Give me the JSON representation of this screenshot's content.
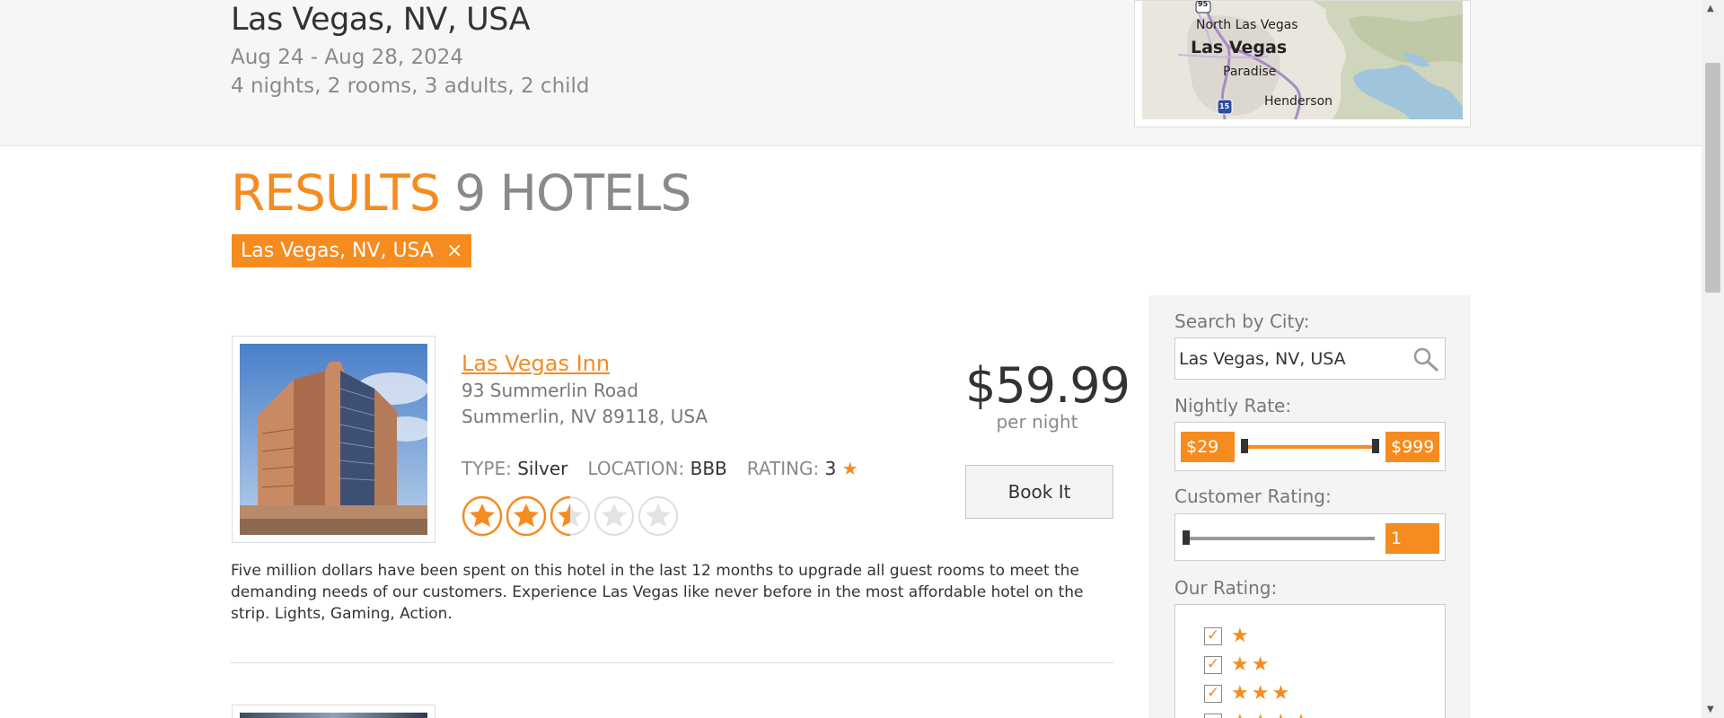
{
  "search_summary": {
    "destination": "Las Vegas, NV, USA",
    "dates": "Aug 24 - Aug 28, 2024",
    "summary": "4 nights, 2 rooms, 3 adults, 2 child"
  },
  "map": {
    "labels": {
      "route_95": "95",
      "north_las_vegas": "North Las Vegas",
      "las_vegas": "Las Vegas",
      "paradise": "Paradise",
      "route_15": "15",
      "henderson": "Henderson"
    }
  },
  "results": {
    "word": "RESULTS",
    "count": "9 HOTELS"
  },
  "active_filter": {
    "label": "Las Vegas, NV, USA",
    "remove": "×"
  },
  "hotels": [
    {
      "name": "Las Vegas Inn",
      "address_line1": "93 Summerlin Road",
      "address_line2": "Summerlin, NV 89118, USA",
      "type_label": "TYPE:",
      "type_value": "Silver",
      "location_label": "LOCATION:",
      "location_value": "BBB",
      "rating_label": "RATING:",
      "rating_value": "3",
      "review_stars": 2.5,
      "review_stars_max": 5,
      "price": "$59.99",
      "per_night": "per night",
      "book_label": "Book It",
      "description": "Five million dollars have been spent on this hotel in the last 12 months to upgrade all guest rooms to meet the demanding needs of our customers. Experience Las Vegas like never before in the most affordable hotel on the strip. Lights, Gaming, Action."
    }
  ],
  "sidebar": {
    "city_label": "Search by City:",
    "city_value": "Las Vegas, NV, USA",
    "rate_label": "Nightly Rate:",
    "rate_min": "$29",
    "rate_max": "$999",
    "customer_rating_label": "Customer Rating:",
    "customer_rating_value": "1",
    "our_rating_label": "Our Rating:",
    "our_rating_options": [
      {
        "stars": "★",
        "checked": true
      },
      {
        "stars": "★★",
        "checked": true
      },
      {
        "stars": "★★★",
        "checked": true
      },
      {
        "stars": "★★★★",
        "checked": false
      }
    ]
  },
  "colors": {
    "accent": "#f68b1f",
    "muted_text": "#8a8a8a",
    "band_background": "#f6f6f6"
  }
}
